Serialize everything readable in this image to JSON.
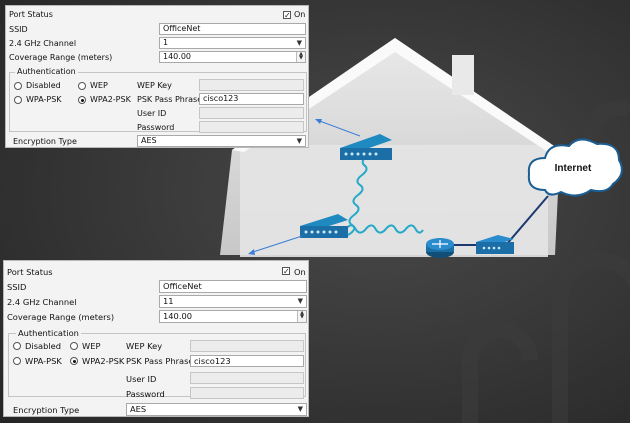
{
  "colors": {
    "background": "#333333",
    "panel": "#f3f3f3",
    "router": "#1b6fa6",
    "cloud_stroke": "#1a5e93"
  },
  "network_diagram": {
    "cloud_label": "Internet"
  },
  "config_top": {
    "port_status_label": "Port Status",
    "on_label": "On",
    "on_checked": true,
    "ssid_label": "SSID",
    "ssid_value": "OfficeNet",
    "channel_label": "2.4 GHz Channel",
    "channel_value": "1",
    "range_label": "Coverage Range (meters)",
    "range_value": "140.00",
    "auth_title": "Authentication",
    "auth_options": [
      "Disabled",
      "WEP",
      "WPA-PSK",
      "WPA2-PSK"
    ],
    "auth_selected": "WPA2-PSK",
    "wep_key_label": "WEP Key",
    "psk_label": "PSK Pass Phrase",
    "psk_value": "cisco123",
    "user_id_label": "User ID",
    "password_label": "Password",
    "encryption_label": "Encryption Type",
    "encryption_value": "AES"
  },
  "config_bottom": {
    "port_status_label": "Port Status",
    "on_label": "On",
    "on_checked": true,
    "ssid_label": "SSID",
    "ssid_value": "OfficeNet",
    "channel_label": "2.4 GHz Channel",
    "channel_value": "11",
    "range_label": "Coverage Range (meters)",
    "range_value": "140.00",
    "auth_title": "Authentication",
    "auth_options": [
      "Disabled",
      "WEP",
      "WPA-PSK",
      "WPA2-PSK"
    ],
    "auth_selected": "WPA2-PSK",
    "wep_key_label": "WEP Key",
    "psk_label": "PSK Pass Phrase",
    "psk_value": "cisco123",
    "user_id_label": "User ID",
    "password_label": "Password",
    "encryption_label": "Encryption Type",
    "encryption_value": "AES"
  }
}
